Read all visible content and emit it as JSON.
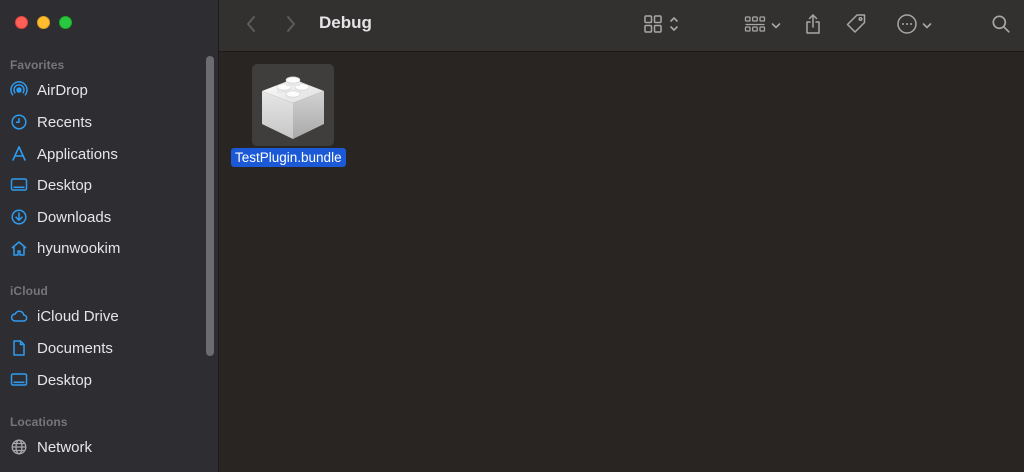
{
  "window": {
    "title": "Debug"
  },
  "sidebar": {
    "sections": [
      {
        "label": "Favorites"
      },
      {
        "label": "iCloud"
      },
      {
        "label": "Locations"
      }
    ],
    "favorites": [
      {
        "label": "AirDrop",
        "icon": "airdrop-icon"
      },
      {
        "label": "Recents",
        "icon": "clock-icon"
      },
      {
        "label": "Applications",
        "icon": "applications-icon"
      },
      {
        "label": "Desktop",
        "icon": "desktop-icon"
      },
      {
        "label": "Downloads",
        "icon": "download-icon"
      },
      {
        "label": "hyunwookim",
        "icon": "home-icon"
      }
    ],
    "icloud": [
      {
        "label": "iCloud Drive",
        "icon": "cloud-icon"
      },
      {
        "label": "Documents",
        "icon": "document-icon"
      },
      {
        "label": "Desktop",
        "icon": "desktop-icon"
      }
    ],
    "locations": [
      {
        "label": "Network",
        "icon": "globe-icon"
      }
    ],
    "accent_color": "#2e9bf0"
  },
  "files": [
    {
      "name": "TestPlugin.bundle",
      "icon": "plugin-bundle-icon",
      "selected": true
    }
  ]
}
